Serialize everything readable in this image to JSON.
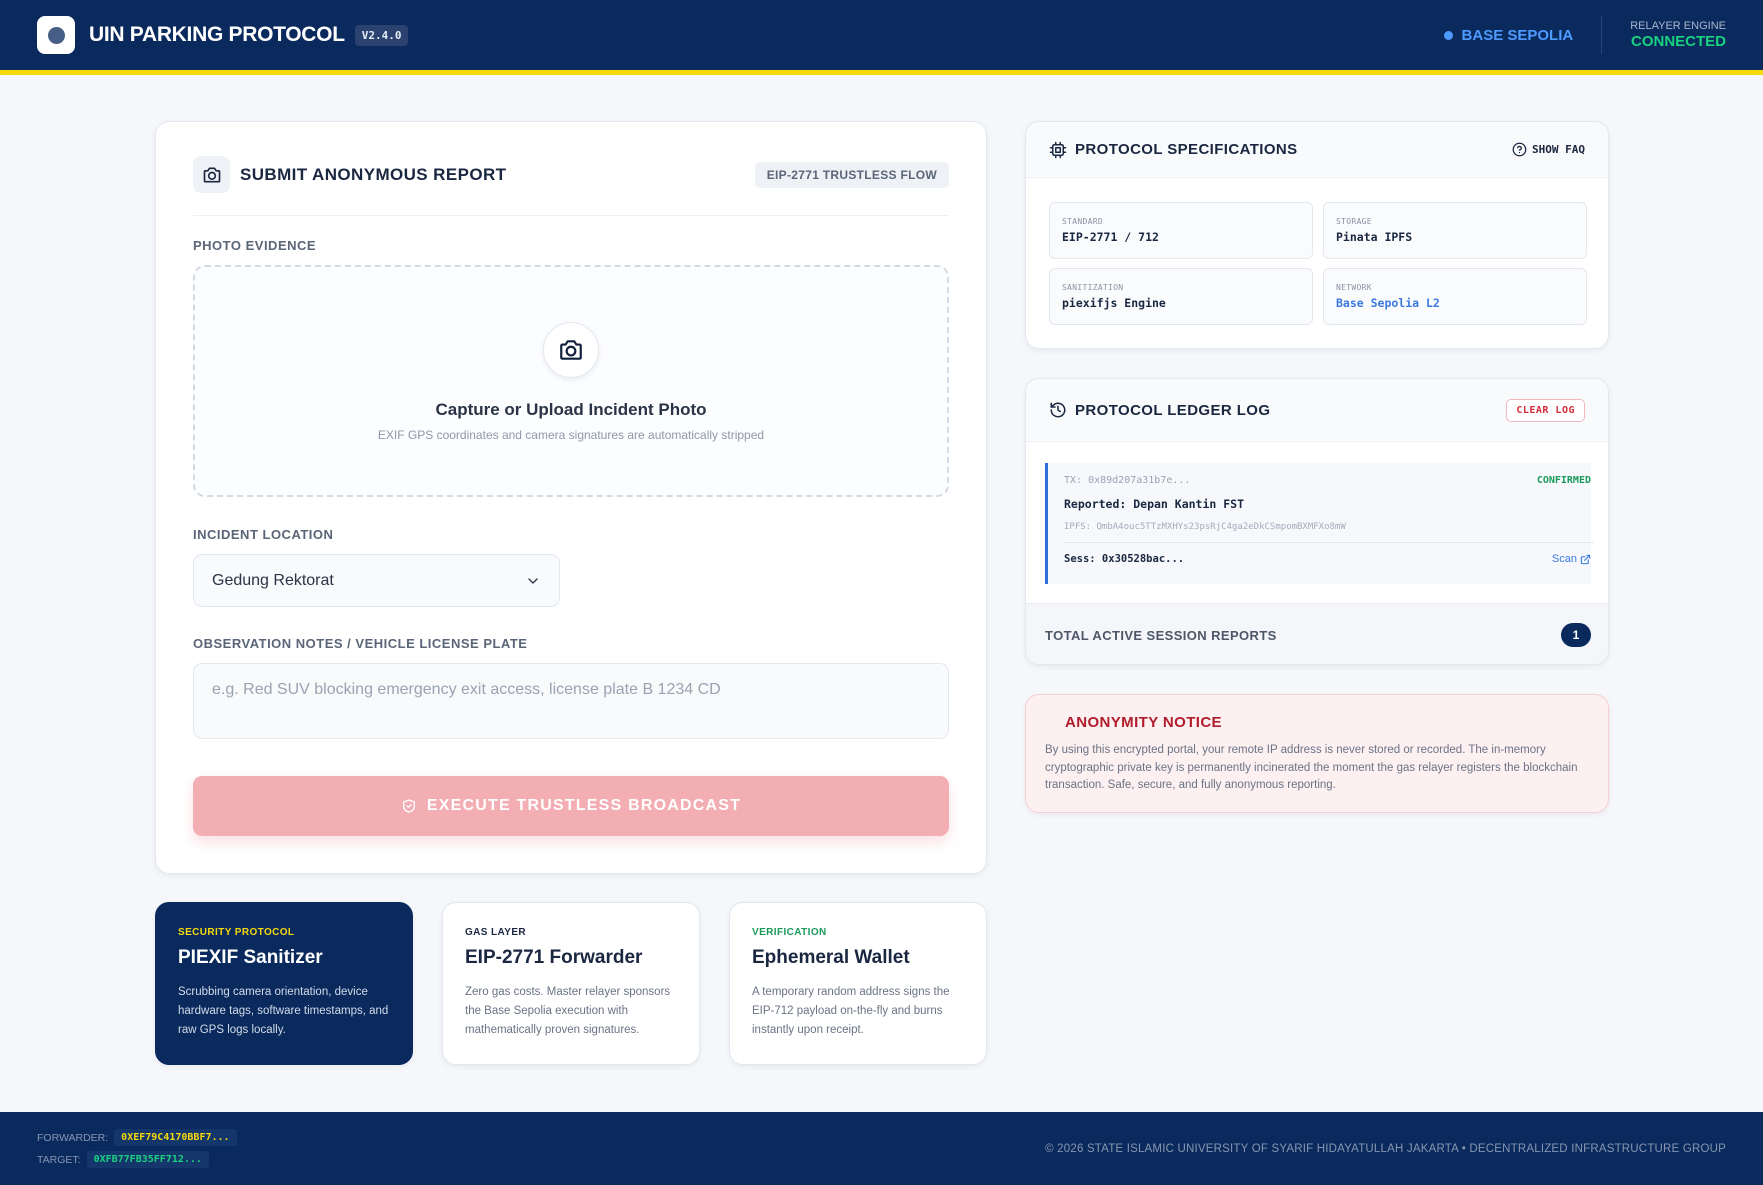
{
  "header": {
    "brand": "UIN PARKING PROTOCOL",
    "version": "V2.4.0",
    "network": "BASE SEPOLIA",
    "relayer_label": "RELAYER ENGINE",
    "relayer_status": "CONNECTED"
  },
  "form": {
    "title": "SUBMIT ANONYMOUS REPORT",
    "flow_tag": "EIP-2771 TRUSTLESS FLOW",
    "photo_label": "PHOTO EVIDENCE",
    "dropzone_title": "Capture or Upload Incident Photo",
    "dropzone_subtitle": "EXIF GPS coordinates and camera signatures are automatically stripped",
    "location_label": "INCIDENT LOCATION",
    "location_value": "Gedung Rektorat",
    "notes_label": "OBSERVATION NOTES / VEHICLE LICENSE PLATE",
    "notes_placeholder": "e.g. Red SUV blocking emergency exit access, license plate B 1234 CD",
    "submit_label": "EXECUTE TRUSTLESS BROADCAST"
  },
  "features": [
    {
      "tag": "SECURITY PROTOCOL",
      "title": "PIEXIF Sanitizer",
      "text": "Scrubbing camera orientation, device hardware tags, software timestamps, and raw GPS logs locally."
    },
    {
      "tag": "GAS LAYER",
      "title": "EIP-2771 Forwarder",
      "text": "Zero gas costs. Master relayer sponsors the Base Sepolia execution with mathematically proven signatures."
    },
    {
      "tag": "VERIFICATION",
      "title": "Ephemeral Wallet",
      "text": "A temporary random address signs the EIP-712 payload on-the-fly and burns instantly upon receipt."
    }
  ],
  "specs": {
    "title": "PROTOCOL SPECIFICATIONS",
    "faq_label": "SHOW FAQ",
    "items": [
      {
        "label": "STANDARD",
        "value": "EIP-2771 / 712"
      },
      {
        "label": "STORAGE",
        "value": "Pinata IPFS"
      },
      {
        "label": "SANITIZATION",
        "value": "piexifjs Engine"
      },
      {
        "label": "NETWORK",
        "value": "Base Sepolia L2"
      }
    ]
  },
  "ledger": {
    "title": "PROTOCOL LEDGER LOG",
    "clear_label": "CLEAR LOG",
    "entry": {
      "tx": "TX: 0x89d207a31b7e...",
      "status": "CONFIRMED",
      "reported": "Reported: Depan Kantin FST",
      "ipfs": "IPFS: QmbA4ouc5TTzMXHYs23psRjC4ga2eDkCSmpomBXMFXo8mW",
      "session": "Sess: 0x30528bac...",
      "scan_label": "Scan"
    },
    "total_label": "TOTAL ACTIVE SESSION REPORTS",
    "total_count": "1"
  },
  "notice": {
    "title": "ANONYMITY NOTICE",
    "text": "By using this encrypted portal, your remote IP address is never stored or recorded. The in-memory cryptographic private key is permanently incinerated the moment the gas relayer registers the blockchain transaction. Safe, secure, and fully anonymous reporting."
  },
  "footer": {
    "forwarder_label": "FORWARDER:",
    "forwarder_value": "0XEF79C4170BBF7...",
    "target_label": "TARGET:",
    "target_value": "0XFB77FB35FF712...",
    "copyright": "© 2026 STATE ISLAMIC UNIVERSITY OF SYARIF HIDAYATULLAH JAKARTA • DECENTRALIZED INFRASTRUCTURE GROUP"
  },
  "colors": {
    "navy": "#0a2a5e",
    "accent_yellow": "#f5d90a",
    "success_green": "#19d17f",
    "network_blue": "#4d9bff",
    "danger_red": "#d42c3a",
    "button_pink": "#f3aeb4"
  }
}
